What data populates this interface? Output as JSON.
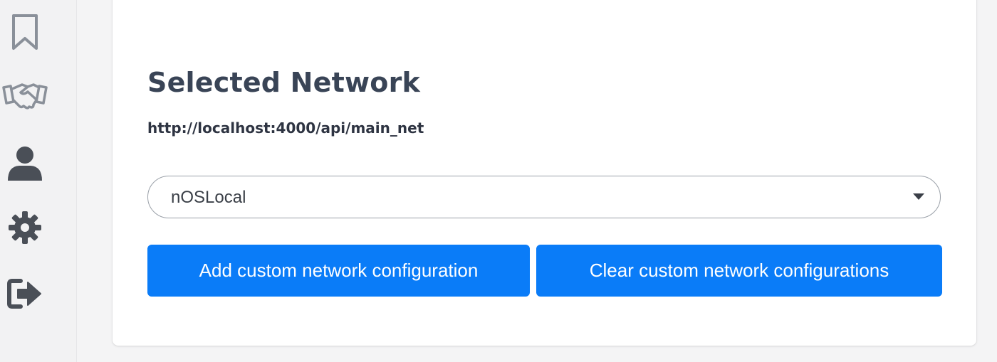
{
  "sidebar": {
    "items": [
      {
        "icon": "bookmark-icon"
      },
      {
        "icon": "handshake-icon"
      },
      {
        "icon": "user-icon"
      },
      {
        "icon": "gear-icon"
      },
      {
        "icon": "logout-icon"
      }
    ],
    "icon_color": "#8a9099",
    "dark_icon_color": "#4a4f57"
  },
  "network": {
    "title": "Selected Network",
    "url": "http://localhost:4000/api/main_net",
    "selected": "nOSLocal"
  },
  "actions": {
    "add_label": "Add custom network configuration",
    "clear_label": "Clear custom network configurations",
    "button_color": "#0a7cf8"
  }
}
